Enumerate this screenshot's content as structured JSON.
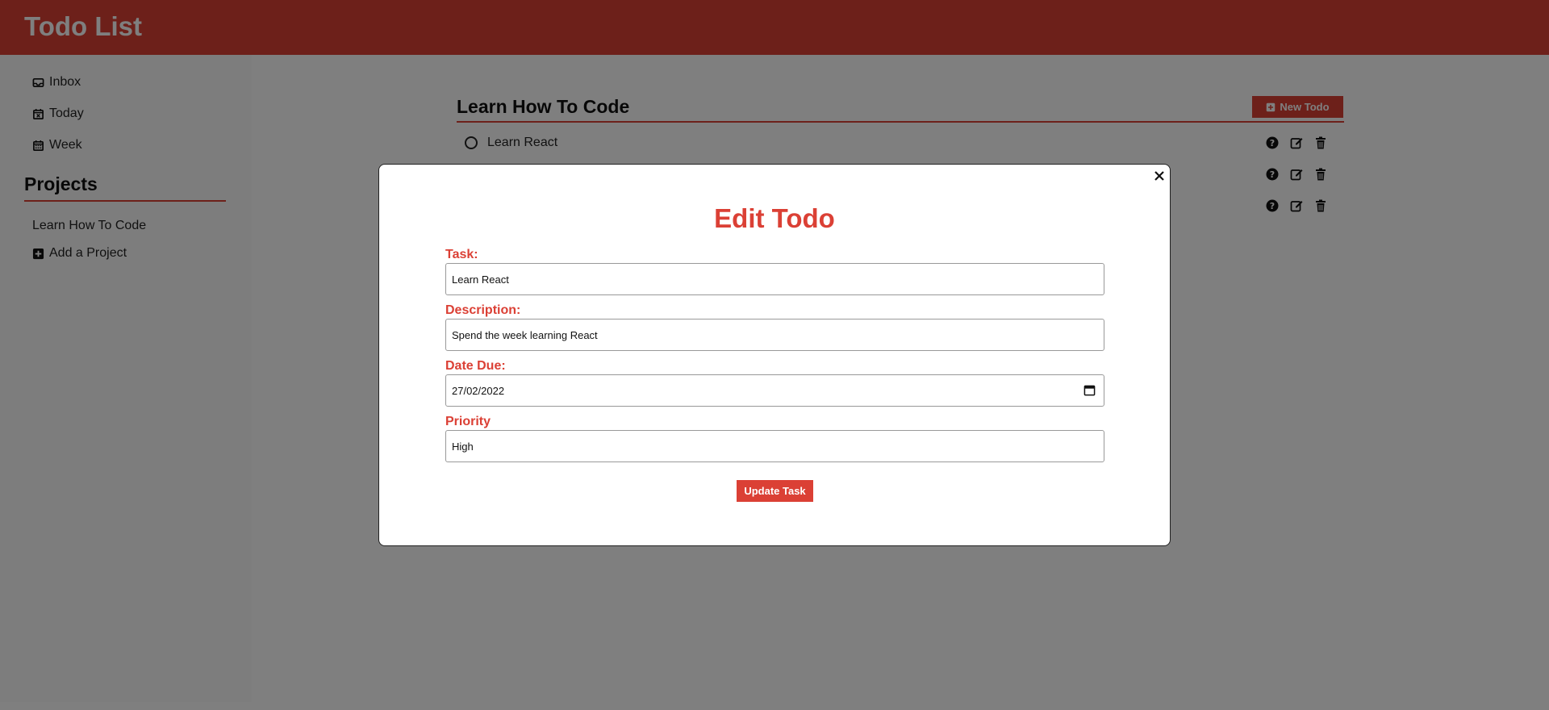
{
  "app": {
    "title": "Todo List"
  },
  "sidebar": {
    "items": [
      {
        "label": "Inbox",
        "icon": "inbox-icon"
      },
      {
        "label": "Today",
        "icon": "calendar-x-icon"
      },
      {
        "label": "Week",
        "icon": "calendar-week-icon"
      }
    ],
    "projects_title": "Projects",
    "projects": [
      {
        "label": "Learn How To Code"
      }
    ],
    "add_project_label": "Add a Project"
  },
  "main": {
    "project_title": "Learn How To Code",
    "new_todo_label": "New Todo",
    "todos": [
      {
        "label": "Learn React"
      }
    ]
  },
  "modal": {
    "title": "Edit Todo",
    "task_label": "Task:",
    "task_value": "Learn React",
    "description_label": "Description:",
    "description_value": "Spend the week learning React",
    "date_label": "Date Due:",
    "date_value": "27/02/2022",
    "priority_label": "Priority",
    "priority_value": "High",
    "submit_label": "Update Task"
  },
  "colors": {
    "accent": "#db4035",
    "overlay": "rgba(0,0,0,0.5)"
  }
}
